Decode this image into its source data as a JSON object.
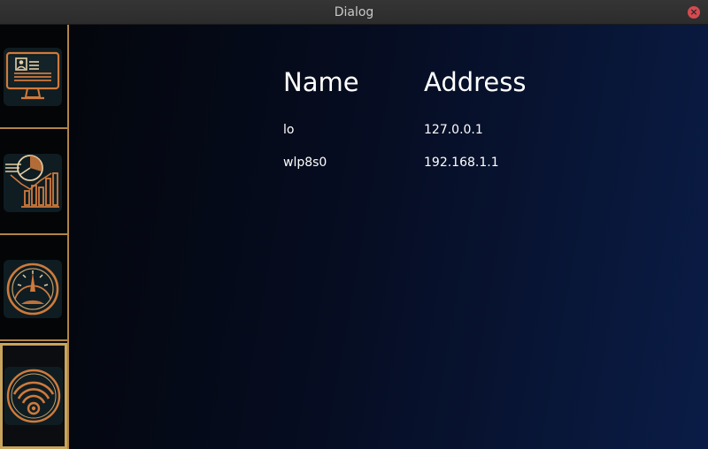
{
  "window": {
    "title": "Dialog",
    "close_glyph": "×"
  },
  "sidebar": {
    "items": [
      {
        "icon": "computer-monitor-icon",
        "active": false
      },
      {
        "icon": "charts-statistics-icon",
        "active": false
      },
      {
        "icon": "speedometer-gauge-icon",
        "active": false
      },
      {
        "icon": "wifi-network-icon",
        "active": true
      }
    ]
  },
  "network_table": {
    "headers": {
      "name": "Name",
      "address": "Address"
    },
    "rows": [
      {
        "name": "lo",
        "address": "127.0.0.1"
      },
      {
        "name": "wlp8s0",
        "address": "192.168.1.1"
      }
    ]
  },
  "colors": {
    "accent": "#c8743a",
    "border_gold": "#b08448",
    "bg_dark": "#04060c",
    "bg_blue": "#0a1c46"
  }
}
